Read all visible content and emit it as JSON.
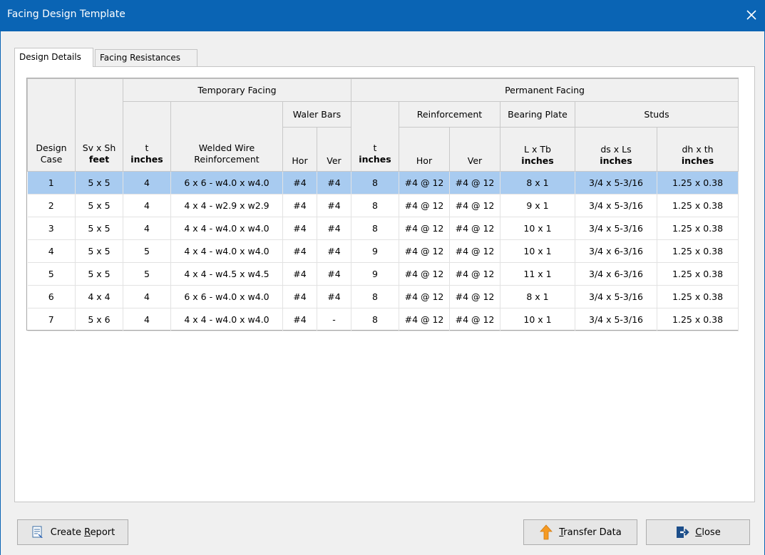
{
  "window": {
    "title": "Facing  Design Template",
    "close_glyph": "✕"
  },
  "tabs": [
    {
      "label": "Design Details",
      "active": true
    },
    {
      "label": "Facing Resistances",
      "active": false
    }
  ],
  "table": {
    "group_headers": {
      "temporary": "Temporary Facing",
      "permanent": "Permanent Facing",
      "waler_bars": "Waler Bars",
      "reinforcement": "Reinforcement",
      "bearing_plate": "Bearing Plate",
      "studs": "Studs"
    },
    "col_headers": {
      "design_case_1": "Design",
      "design_case_2": "Case",
      "svsh_1": "Sv x Sh",
      "svsh_2": "feet",
      "temp_t_1": "t",
      "temp_t_2": "inches",
      "wwr_1": "Welded Wire",
      "wwr_2": "Reinforcement",
      "waler_hor": "Hor",
      "waler_ver": "Ver",
      "perm_t_1": "t",
      "perm_t_2": "inches",
      "reinf_hor": "Hor",
      "reinf_ver": "Ver",
      "plate_1": "L x Tb",
      "plate_2": "inches",
      "dsls_1": "ds x Ls",
      "dsls_2": "inches",
      "dhth_1": "dh x th",
      "dhth_2": "inches"
    },
    "rows": [
      [
        "1",
        "5 x 5",
        "4",
        "6 x 6 - w4.0 x w4.0",
        "#4",
        "#4",
        "8",
        "#4 @ 12",
        "#4 @ 12",
        "8 x 1",
        "3/4 x 5-3/16",
        "1.25 x 0.38"
      ],
      [
        "2",
        "5 x 5",
        "4",
        "4 x 4 - w2.9 x w2.9",
        "#4",
        "#4",
        "8",
        "#4 @ 12",
        "#4 @ 12",
        "9 x 1",
        "3/4 x 5-3/16",
        "1.25 x 0.38"
      ],
      [
        "3",
        "5 x 5",
        "4",
        "4 x 4 - w4.0 x w4.0",
        "#4",
        "#4",
        "8",
        "#4 @ 12",
        "#4 @ 12",
        "10 x 1",
        "3/4 x 5-3/16",
        "1.25 x 0.38"
      ],
      [
        "4",
        "5 x 5",
        "5",
        "4 x 4 - w4.0 x w4.0",
        "#4",
        "#4",
        "9",
        "#4 @ 12",
        "#4 @ 12",
        "10 x 1",
        "3/4 x 6-3/16",
        "1.25 x 0.38"
      ],
      [
        "5",
        "5 x 5",
        "5",
        "4 x 4 - w4.5 x w4.5",
        "#4",
        "#4",
        "9",
        "#4 @ 12",
        "#4 @ 12",
        "11 x 1",
        "3/4 x 6-3/16",
        "1.25 x 0.38"
      ],
      [
        "6",
        "4 x 4",
        "4",
        "6 x 6 - w4.0 x w4.0",
        "#4",
        "#4",
        "8",
        "#4 @ 12",
        "#4 @ 12",
        "8 x 1",
        "3/4 x 5-3/16",
        "1.25 x 0.38"
      ],
      [
        "7",
        "5 x 6",
        "4",
        "4 x 4 - w4.0 x w4.0",
        "#4",
        "-",
        "8",
        "#4 @ 12",
        "#4 @ 12",
        "10 x 1",
        "3/4 x 5-3/16",
        "1.25 x 0.38"
      ]
    ],
    "selected_row": 0,
    "selected_color": "#a8cbf0"
  },
  "buttons": {
    "create_report": {
      "pre": "Create ",
      "accel": "R",
      "post": "eport",
      "icon": "report-icon"
    },
    "transfer_data": {
      "pre": "",
      "accel": "T",
      "post": "ransfer Data",
      "icon": "transfer-arrow-icon"
    },
    "close": {
      "pre": "",
      "accel": "C",
      "post": "lose",
      "icon": "exit-door-icon"
    }
  },
  "colors": {
    "titlebar": "#0a64b4",
    "transfer_arrow": "#f59a23",
    "exit_icon": "#1c4e8a"
  }
}
